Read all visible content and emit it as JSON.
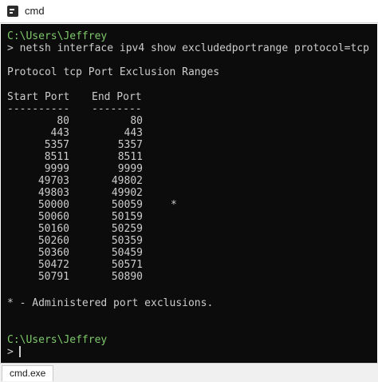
{
  "window": {
    "title": "cmd",
    "app_icon": "console-icon"
  },
  "terminal": {
    "prompt_path": "C:\\Users\\Jeffrey",
    "command_line": "> netsh interface ipv4 show excludedportrange protocol=tcp",
    "heading": "Protocol tcp Port Exclusion Ranges",
    "col_start_header": "Start Port",
    "col_end_header": "End Port",
    "col_start_rule": "----------",
    "col_end_rule": "--------",
    "rows": [
      {
        "start": "80",
        "end": "80",
        "mark": ""
      },
      {
        "start": "443",
        "end": "443",
        "mark": ""
      },
      {
        "start": "5357",
        "end": "5357",
        "mark": ""
      },
      {
        "start": "8511",
        "end": "8511",
        "mark": ""
      },
      {
        "start": "9999",
        "end": "9999",
        "mark": ""
      },
      {
        "start": "49703",
        "end": "49802",
        "mark": ""
      },
      {
        "start": "49803",
        "end": "49902",
        "mark": ""
      },
      {
        "start": "50000",
        "end": "50059",
        "mark": "*"
      },
      {
        "start": "50060",
        "end": "50159",
        "mark": ""
      },
      {
        "start": "50160",
        "end": "50259",
        "mark": ""
      },
      {
        "start": "50260",
        "end": "50359",
        "mark": ""
      },
      {
        "start": "50360",
        "end": "50459",
        "mark": ""
      },
      {
        "start": "50472",
        "end": "50571",
        "mark": ""
      },
      {
        "start": "50791",
        "end": "50890",
        "mark": ""
      }
    ],
    "footnote": "* - Administered port exclusions.",
    "prompt_path_2": "C:\\Users\\Jeffrey",
    "prompt_symbol": ">"
  },
  "statusbar": {
    "tab_label": "cmd.exe"
  },
  "colors": {
    "terminal_bg": "#0c0c0c",
    "terminal_fg": "#cccccc",
    "prompt_green": "#7ec96a"
  }
}
